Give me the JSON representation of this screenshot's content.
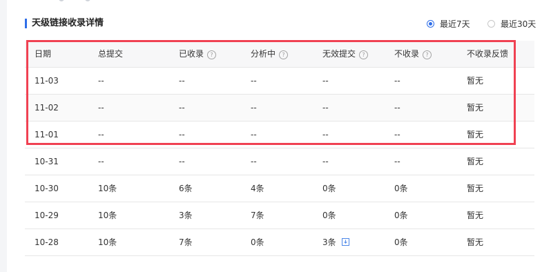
{
  "section": {
    "title": "天级链接收录详情"
  },
  "range": {
    "option_7": "最近7天",
    "option_30": "最近30天",
    "selected": "最近7天"
  },
  "table": {
    "headers": [
      "日期",
      "总提交",
      "已收录",
      "分析中",
      "无效提交",
      "不收录",
      "不收录反馈"
    ],
    "rows": [
      [
        "11-03",
        "--",
        "--",
        "--",
        "--",
        "--",
        "暂无"
      ],
      [
        "11-02",
        "--",
        "--",
        "--",
        "--",
        "--",
        "暂无"
      ],
      [
        "11-01",
        "--",
        "--",
        "--",
        "--",
        "--",
        "暂无"
      ],
      [
        "10-31",
        "--",
        "--",
        "--",
        "--",
        "--",
        "暂无"
      ],
      [
        "10-30",
        "10条",
        "6条",
        "4条",
        "0条",
        "0条",
        "暂无"
      ],
      [
        "10-29",
        "10条",
        "3条",
        "7条",
        "0条",
        "0条",
        "暂无"
      ],
      [
        "10-28",
        "10条",
        "7条",
        "0条",
        "3条",
        "0条",
        "暂无"
      ]
    ]
  },
  "colors": {
    "accent": "#2f6ee8",
    "highlight": "#f04152"
  }
}
